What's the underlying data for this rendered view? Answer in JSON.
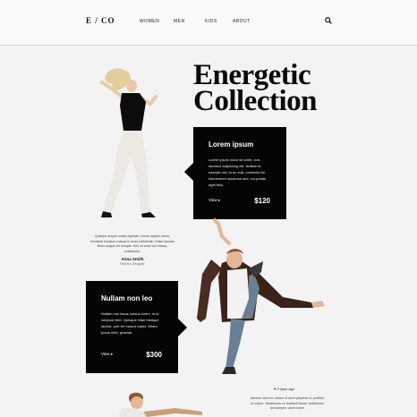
{
  "header": {
    "logo": "E / CO",
    "nav": [
      "WOMEN",
      "MEN",
      "KIDS",
      "ABOUT"
    ]
  },
  "hero": {
    "title_line1": "Energetic",
    "title_line2": "Collection"
  },
  "card1": {
    "title": "Lorem ipsum",
    "body": "Lorem ipsum dolor sit amet, con-sectetur adipiscing elit. Nullam et suscipit nisl, in eu erat, consecte-tur elementum maximus sed, vul-putate eget felis.",
    "view": "View",
    "price": "$120"
  },
  "testimonial": {
    "quote": "Quisque aliquet mattis egestas. Donec sapien lorem, hendrerit tincidunt massa in amet sollicitudin. Etiam facilisis libero augue vel semper. Sed sit amet dui massa, vestibulum.",
    "author": "Anna Smith",
    "role": "Fashion Designer"
  },
  "card2": {
    "title": "Nullam non leo",
    "body": "Nullam non lacus cursus lorem, in ut volutpat nibh. Quisque vitae tristique lacinia, port tor mauris turpis. Etiam purus nibh, gravida.",
    "view": "View",
    "price": "$300"
  },
  "tweet": {
    "meta": "3 days ago",
    "text": "Aenean sed est, rutrum id amet placerat ut, porttitor et neque. Vestibulum eu tincidunt tellus, vestibulum sed semper. amet lorem"
  },
  "colors": {
    "background": "#f3f3f3",
    "card": "#050505",
    "text": "#111111"
  }
}
